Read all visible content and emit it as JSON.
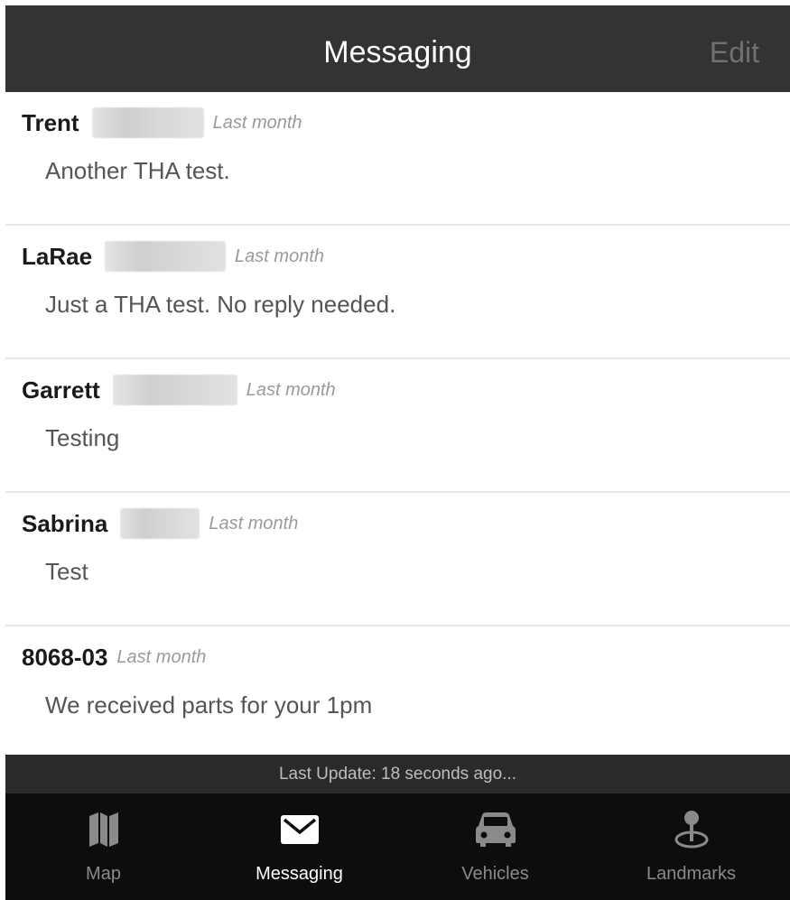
{
  "header": {
    "title": "Messaging",
    "edit_label": "Edit"
  },
  "messages": [
    {
      "sender": "Trent",
      "time": "Last month",
      "preview": "Another THA test."
    },
    {
      "sender": "LaRae",
      "time": "Last month",
      "preview": "Just a THA test. No reply needed."
    },
    {
      "sender": "Garrett",
      "time": "Last month",
      "preview": "Testing"
    },
    {
      "sender": "Sabrina",
      "time": "Last month",
      "preview": "Test"
    },
    {
      "sender": "8068-03",
      "time": "Last month",
      "preview": "We received parts for your 1pm"
    }
  ],
  "status": {
    "last_update": "Last Update: 18 seconds ago..."
  },
  "tabs": [
    {
      "label": "Map",
      "icon": "map-icon"
    },
    {
      "label": "Messaging",
      "icon": "envelope-icon",
      "active": true
    },
    {
      "label": "Vehicles",
      "icon": "car-icon"
    },
    {
      "label": "Landmarks",
      "icon": "landmark-pin-icon"
    }
  ],
  "colors": {
    "header_bg": "#333333",
    "tabbar_bg": "#0d0d0d",
    "status_bar_bg": "#2a2a2a",
    "active_tab": "#ffffff",
    "inactive_tab": "#8a8a8a"
  }
}
